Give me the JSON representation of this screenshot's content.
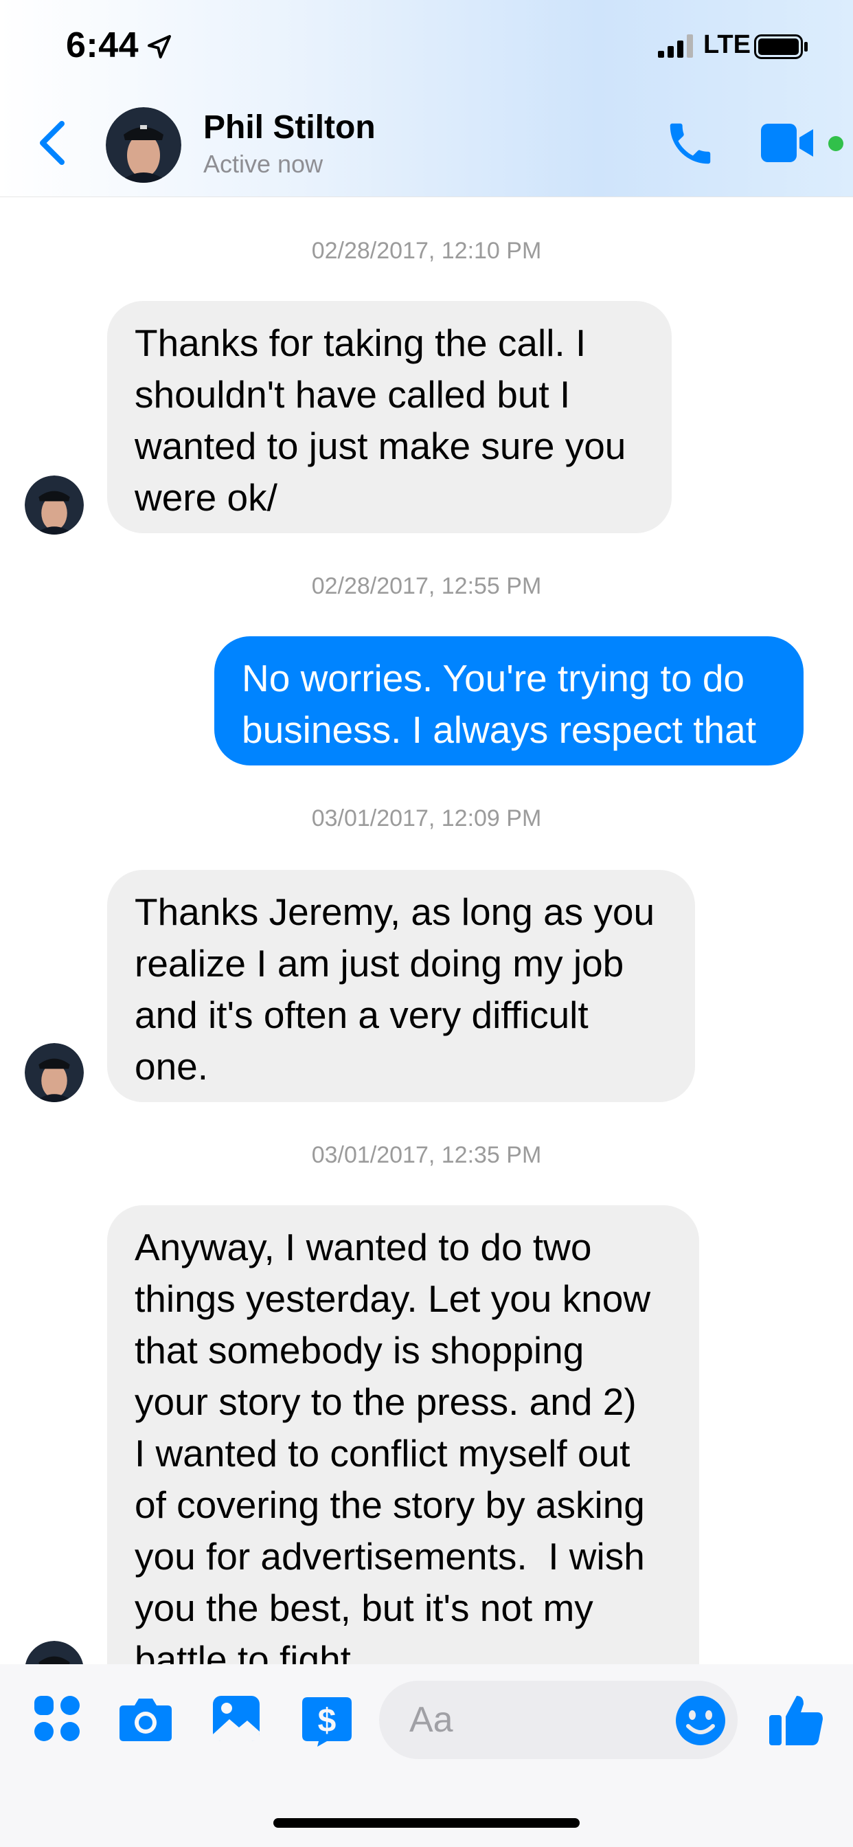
{
  "status_bar": {
    "time": "6:44",
    "network": "LTE"
  },
  "header": {
    "contact_name": "Phil Stilton",
    "contact_status": "Active now"
  },
  "messages": [
    {
      "timestamp": "02/28/2017, 12:10 PM",
      "direction": "incoming",
      "text": "Thanks for taking the call. I\nshouldn't have called but I\nwanted to just make sure you\nwere ok/"
    },
    {
      "timestamp": "02/28/2017, 12:55 PM",
      "direction": "outgoing",
      "text": "No worries. You're trying to do\nbusiness. I always respect that"
    },
    {
      "timestamp": "03/01/2017, 12:09 PM",
      "direction": "incoming",
      "text": "Thanks Jeremy, as long as you\nrealize I am just doing my job\nand it's often a very difficult\none."
    },
    {
      "timestamp": "03/01/2017, 12:35 PM",
      "direction": "incoming",
      "text": "Anyway, I wanted to do two\nthings yesterday. Let you know\nthat somebody is shopping\nyour story to the press. and 2)\nI wanted to conflict myself out\nof covering the story by asking\nyou for advertisements.  I wish\nyou the best, but it's not my\nbattle to fight"
    }
  ],
  "composer": {
    "placeholder": "Aa"
  },
  "colors": {
    "accent": "#0084ff",
    "incoming_bubble": "#efefef",
    "online": "#31c04a"
  }
}
